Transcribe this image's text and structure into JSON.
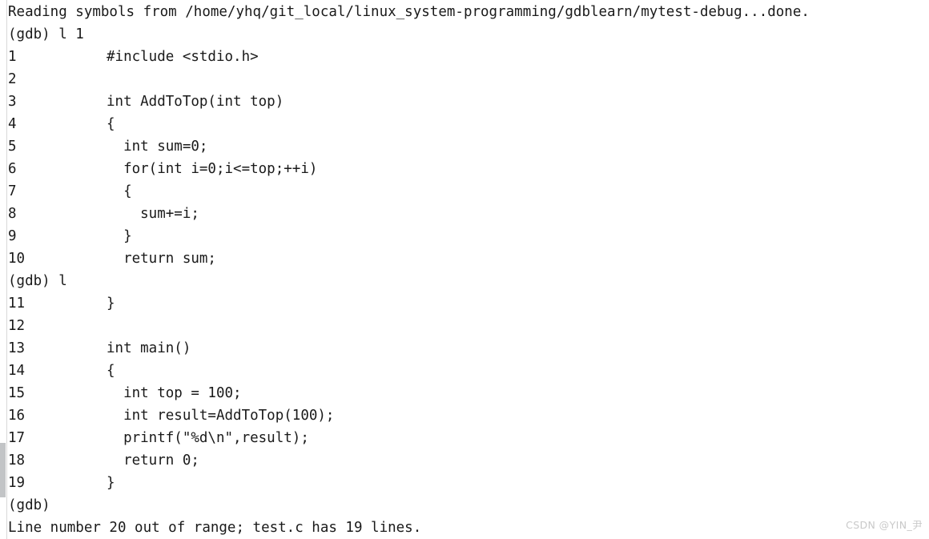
{
  "terminal": {
    "background_color": "#ffffff",
    "text_color": "#1a1a1a",
    "program": "gdb"
  },
  "scrollbar": {
    "name": "vertical-scrollbar",
    "track_color": "#ffffff",
    "thumb_color": "#c2c4c6"
  },
  "watermark": {
    "text": "CSDN @YIN_尹",
    "color": "#c9c9c9"
  },
  "lines": [
    {
      "type": "message",
      "text": "Reading symbols from /home/yhq/git_local/linux_system-programming/gdblearn/mytest-debug...done."
    },
    {
      "type": "prompt",
      "text": "(gdb) l 1"
    },
    {
      "type": "source",
      "number": "1",
      "code": "#include <stdio.h>"
    },
    {
      "type": "source",
      "number": "2",
      "code": ""
    },
    {
      "type": "source",
      "number": "3",
      "code": "int AddToTop(int top)"
    },
    {
      "type": "source",
      "number": "4",
      "code": "{"
    },
    {
      "type": "source",
      "number": "5",
      "code": "  int sum=0;"
    },
    {
      "type": "source",
      "number": "6",
      "code": "  for(int i=0;i<=top;++i)"
    },
    {
      "type": "source",
      "number": "7",
      "code": "  {"
    },
    {
      "type": "source",
      "number": "8",
      "code": "    sum+=i;"
    },
    {
      "type": "source",
      "number": "9",
      "code": "  }"
    },
    {
      "type": "source",
      "number": "10",
      "code": "  return sum;"
    },
    {
      "type": "prompt",
      "text": "(gdb) l"
    },
    {
      "type": "source",
      "number": "11",
      "code": "}"
    },
    {
      "type": "source",
      "number": "12",
      "code": ""
    },
    {
      "type": "source",
      "number": "13",
      "code": "int main()"
    },
    {
      "type": "source",
      "number": "14",
      "code": "{"
    },
    {
      "type": "source",
      "number": "15",
      "code": "  int top = 100;"
    },
    {
      "type": "source",
      "number": "16",
      "code": "  int result=AddToTop(100);"
    },
    {
      "type": "source",
      "number": "17",
      "code": "  printf(\"%d\\n\",result);"
    },
    {
      "type": "source",
      "number": "18",
      "code": "  return 0;"
    },
    {
      "type": "source",
      "number": "19",
      "code": "}"
    },
    {
      "type": "prompt",
      "text": "(gdb)"
    },
    {
      "type": "message",
      "text": "Line number 20 out of range; test.c has 19 lines."
    }
  ]
}
